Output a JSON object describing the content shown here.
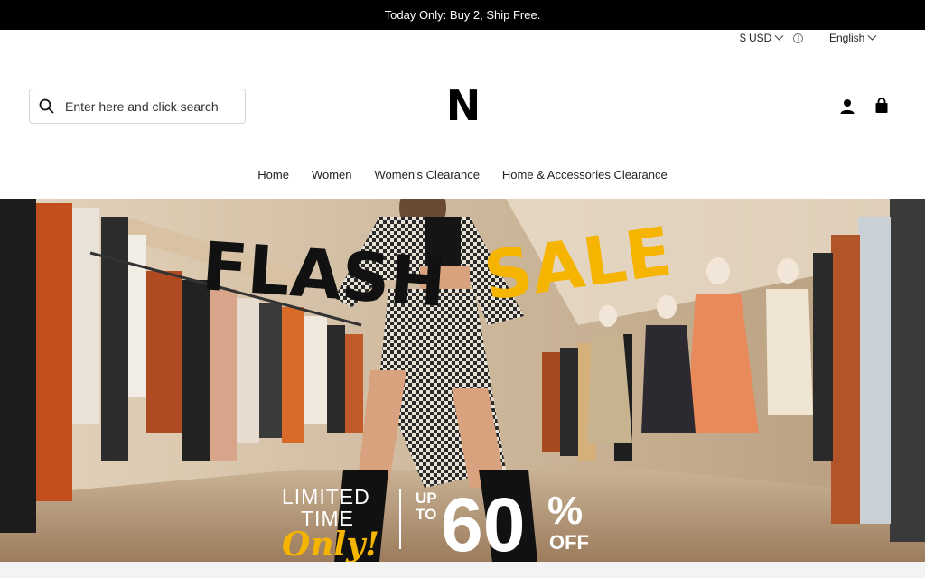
{
  "announcement": {
    "text": "Today Only: Buy 2, Ship Free."
  },
  "utility": {
    "currency": "$ USD",
    "language": "English"
  },
  "header": {
    "search_placeholder": "Enter here and click search",
    "logo": "N"
  },
  "nav": {
    "items": [
      {
        "label": "Home"
      },
      {
        "label": "Women"
      },
      {
        "label": "Women's Clearance"
      },
      {
        "label": "Home & Accessories Clearance"
      }
    ]
  },
  "hero": {
    "title_word1": "FLASH",
    "title_word2": "SALE",
    "limited": "LIMITED",
    "time": "TIME",
    "only": "Only!",
    "up": "UP",
    "to": "TO",
    "percent_value": "60",
    "percent_sign": "%",
    "off": "OFF",
    "colors": {
      "sale_yellow": "#f5b400",
      "black": "#111111"
    }
  }
}
